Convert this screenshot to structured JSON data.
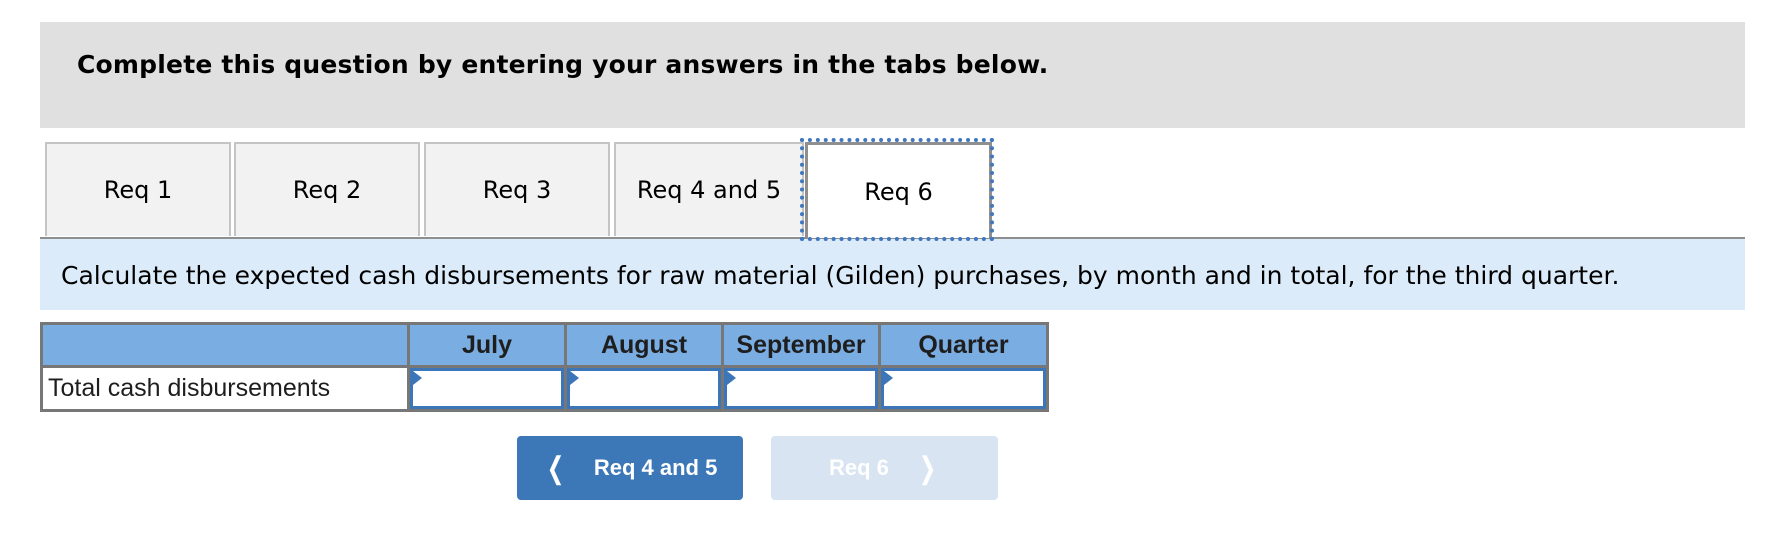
{
  "header": {
    "instruction": "Complete this question by entering your answers in the tabs below."
  },
  "tabs": [
    {
      "label": "Req 1",
      "active": false
    },
    {
      "label": "Req 2",
      "active": false
    },
    {
      "label": "Req 3",
      "active": false
    },
    {
      "label": "Req 4 and 5",
      "active": false
    },
    {
      "label": "Req 6",
      "active": true
    }
  ],
  "question": {
    "text": "Calculate the expected cash disbursements for raw material (Gilden) purchases, by month and in total, for the third quarter."
  },
  "table": {
    "columns": [
      "",
      "July",
      "August",
      "September",
      "Quarter"
    ],
    "rows": [
      {
        "label": "Total cash disbursements",
        "values": [
          "",
          "",
          "",
          ""
        ]
      }
    ]
  },
  "nav": {
    "prev": {
      "label": "Req 4 and 5",
      "icon": "chevron-left-icon",
      "enabled": true
    },
    "next": {
      "label": "Req 6",
      "icon": "chevron-right-icon",
      "enabled": false
    }
  },
  "colors": {
    "accent": "#3c78b7",
    "table_header": "#7aade2",
    "instruction_band": "#dbebf9",
    "header_band": "#e0e0e0",
    "disabled_button": "#d8e4f1"
  }
}
